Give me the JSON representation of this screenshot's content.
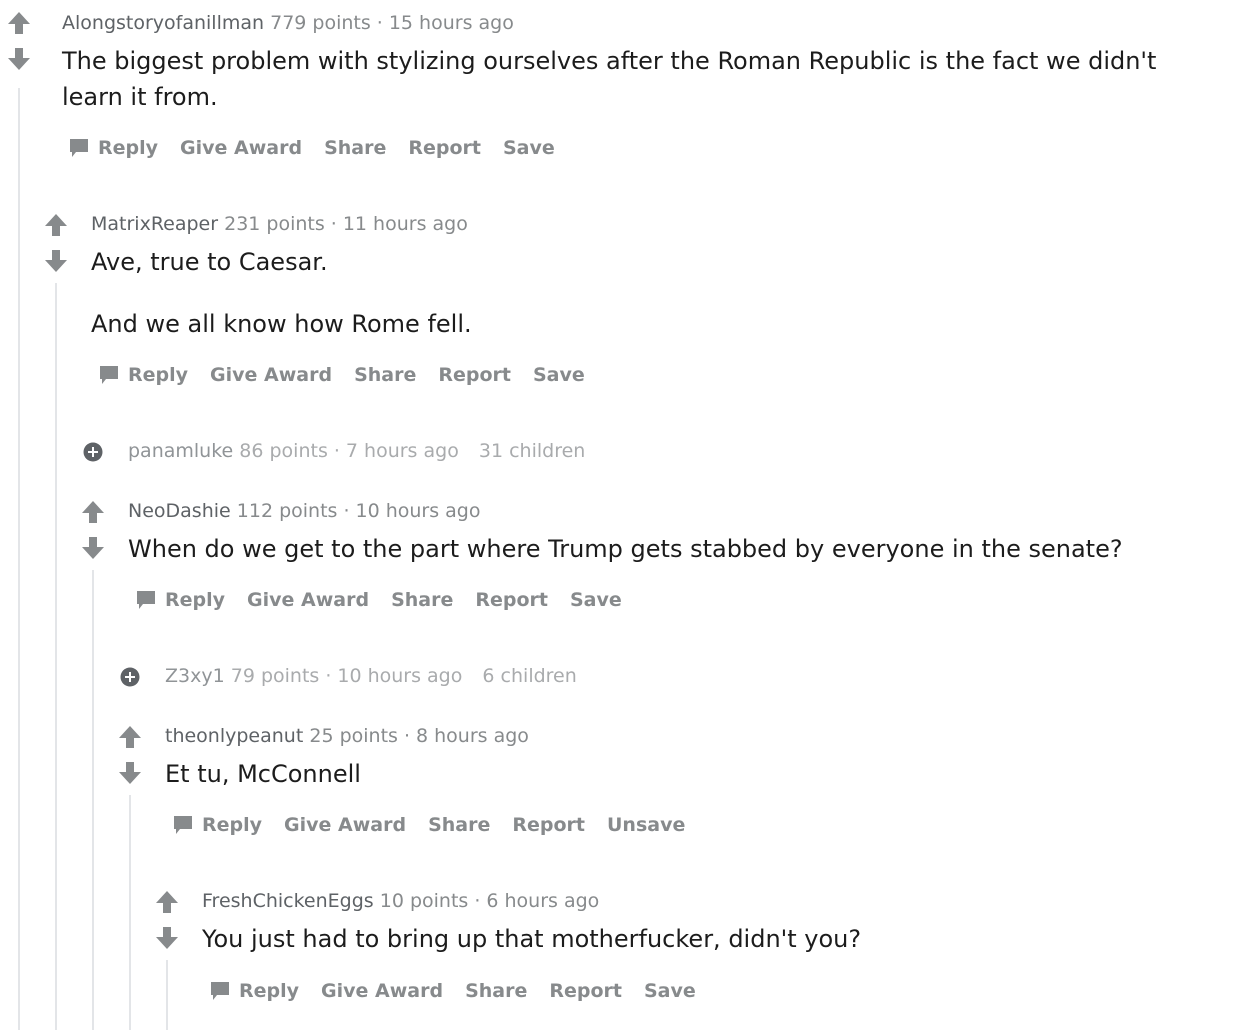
{
  "labels": {
    "points": "points",
    "reply": "Reply",
    "give_award": "Give Award",
    "share": "Share",
    "report": "Report",
    "save": "Save",
    "unsave": "Unsave",
    "children": "children",
    "dot": "·"
  },
  "comments": [
    {
      "author": "Alongstoryofanillman",
      "points": "779 points",
      "time": "15 hours ago",
      "body": "The biggest problem with stylizing ourselves after the Roman Republic is the fact we didn't learn it from.",
      "save_label": "Save"
    },
    {
      "author": "MatrixReaper",
      "points": "231 points",
      "time": "11 hours ago",
      "body_lines": [
        "Ave, true to Caesar.",
        "And we all know how Rome fell."
      ],
      "save_label": "Save"
    },
    {
      "author": "panamluke",
      "points": "86 points",
      "time": "7 hours ago",
      "children": "31 children",
      "collapsed": true
    },
    {
      "author": "NeoDashie",
      "points": "112 points",
      "time": "10 hours ago",
      "body": "When do we get to the part where Trump gets stabbed by everyone in the senate?",
      "save_label": "Save"
    },
    {
      "author": "Z3xy1",
      "points": "79 points",
      "time": "10 hours ago",
      "children": "6 children",
      "collapsed": true
    },
    {
      "author": "theonlypeanut",
      "points": "25 points",
      "time": "8 hours ago",
      "body": "Et tu, McConnell",
      "save_label": "Unsave"
    },
    {
      "author": "FreshChickenEggs",
      "points": "10 points",
      "time": "6 hours ago",
      "body": "You just had to bring up that motherfucker, didn't you?",
      "save_label": "Save"
    }
  ],
  "colors": {
    "text": "#1c1c1c",
    "meta": "#878a8c",
    "icon": "#878a8c",
    "thread_line": "#e3e5e8"
  }
}
